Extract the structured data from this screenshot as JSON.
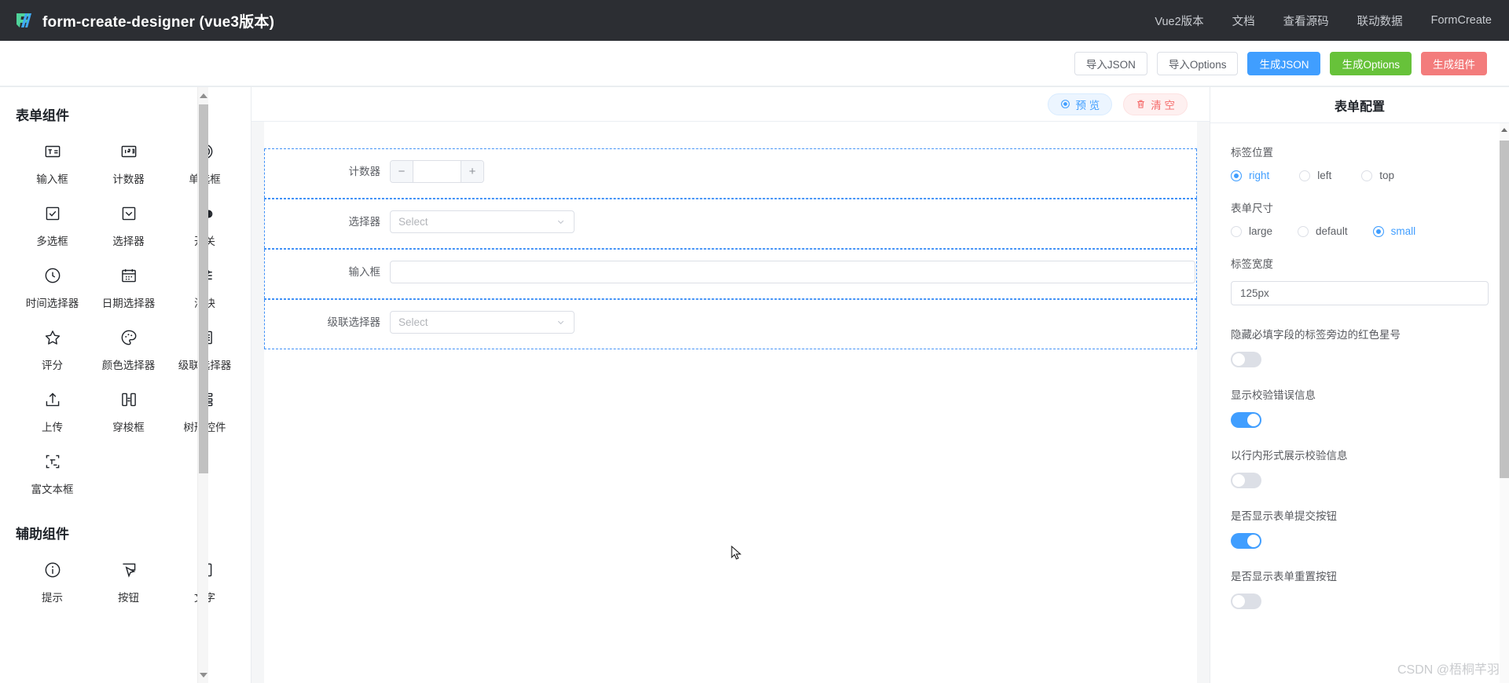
{
  "topbar": {
    "brand_title": "form-create-designer (vue3版本)",
    "logo_icon": "formcreate-logo-icon",
    "nav": [
      {
        "label": "Vue2版本"
      },
      {
        "label": "文档"
      },
      {
        "label": "查看源码"
      },
      {
        "label": "联动数据"
      },
      {
        "label": "FormCreate"
      }
    ]
  },
  "toolbar": {
    "buttons": [
      {
        "label": "导入JSON",
        "style": "default"
      },
      {
        "label": "导入Options",
        "style": "default"
      },
      {
        "label": "生成JSON",
        "style": "primary"
      },
      {
        "label": "生成Options",
        "style": "success"
      },
      {
        "label": "生成组件",
        "style": "danger"
      }
    ]
  },
  "palette": {
    "form_section_title": "表单组件",
    "form_components": [
      {
        "label": "输入框",
        "icon": "text-input-icon"
      },
      {
        "label": "计数器",
        "icon": "number-counter-icon"
      },
      {
        "label": "单选框",
        "icon": "radio-circle-icon"
      },
      {
        "label": "多选框",
        "icon": "checkbox-check-icon"
      },
      {
        "label": "选择器",
        "icon": "select-chevron-icon"
      },
      {
        "label": "开关",
        "icon": "switch-toggle-icon"
      },
      {
        "label": "时间选择器",
        "icon": "clock-icon"
      },
      {
        "label": "日期选择器",
        "icon": "calendar-icon"
      },
      {
        "label": "滑块",
        "icon": "slider-icon"
      },
      {
        "label": "评分",
        "icon": "star-icon"
      },
      {
        "label": "颜色选择器",
        "icon": "color-palette-icon"
      },
      {
        "label": "级联选择器",
        "icon": "cascader-panel-icon"
      },
      {
        "label": "上传",
        "icon": "upload-icon"
      },
      {
        "label": "穿梭框",
        "icon": "transfer-icon"
      },
      {
        "label": "树形控件",
        "icon": "tree-icon"
      },
      {
        "label": "富文本框",
        "icon": "rich-text-icon"
      }
    ],
    "aux_section_title": "辅助组件",
    "aux_components": [
      {
        "label": "提示",
        "icon": "info-circle-icon"
      },
      {
        "label": "按钮",
        "icon": "button-click-icon"
      },
      {
        "label": "文字",
        "icon": "text-t-icon"
      }
    ]
  },
  "canvas": {
    "preview_button": "预 览",
    "preview_icon": "eye-icon",
    "clear_button": "清 空",
    "clear_icon": "trash-icon",
    "fields": [
      {
        "label": "计数器",
        "type": "input-number",
        "value": "",
        "minus": "−",
        "plus": "+"
      },
      {
        "label": "选择器",
        "type": "select",
        "placeholder": "Select"
      },
      {
        "label": "输入框",
        "type": "input",
        "value": "",
        "placeholder": ""
      },
      {
        "label": "级联选择器",
        "type": "cascader",
        "placeholder": "Select"
      }
    ]
  },
  "config": {
    "title": "表单配置",
    "label_position": {
      "label": "标签位置",
      "options": [
        {
          "label": "right",
          "selected": true
        },
        {
          "label": "left",
          "selected": false
        },
        {
          "label": "top",
          "selected": false
        }
      ]
    },
    "form_size": {
      "label": "表单尺寸",
      "options": [
        {
          "label": "large",
          "selected": false
        },
        {
          "label": "default",
          "selected": false
        },
        {
          "label": "small",
          "selected": true
        }
      ]
    },
    "label_width": {
      "label": "标签宽度",
      "value": "125px"
    },
    "switches": [
      {
        "label": "隐藏必填字段的标签旁边的红色星号",
        "on": false
      },
      {
        "label": "显示校验错误信息",
        "on": true
      },
      {
        "label": "以行内形式展示校验信息",
        "on": false
      },
      {
        "label": "是否显示表单提交按钮",
        "on": true
      },
      {
        "label": "是否显示表单重置按钮",
        "on": false
      }
    ]
  },
  "watermark": "CSDN @梧桐芊羽",
  "colors": {
    "topbar_bg": "#2c2e33",
    "primary": "#409eff",
    "success": "#67c23a",
    "danger": "#f37c7c",
    "dashed_border": "#4091f7"
  }
}
